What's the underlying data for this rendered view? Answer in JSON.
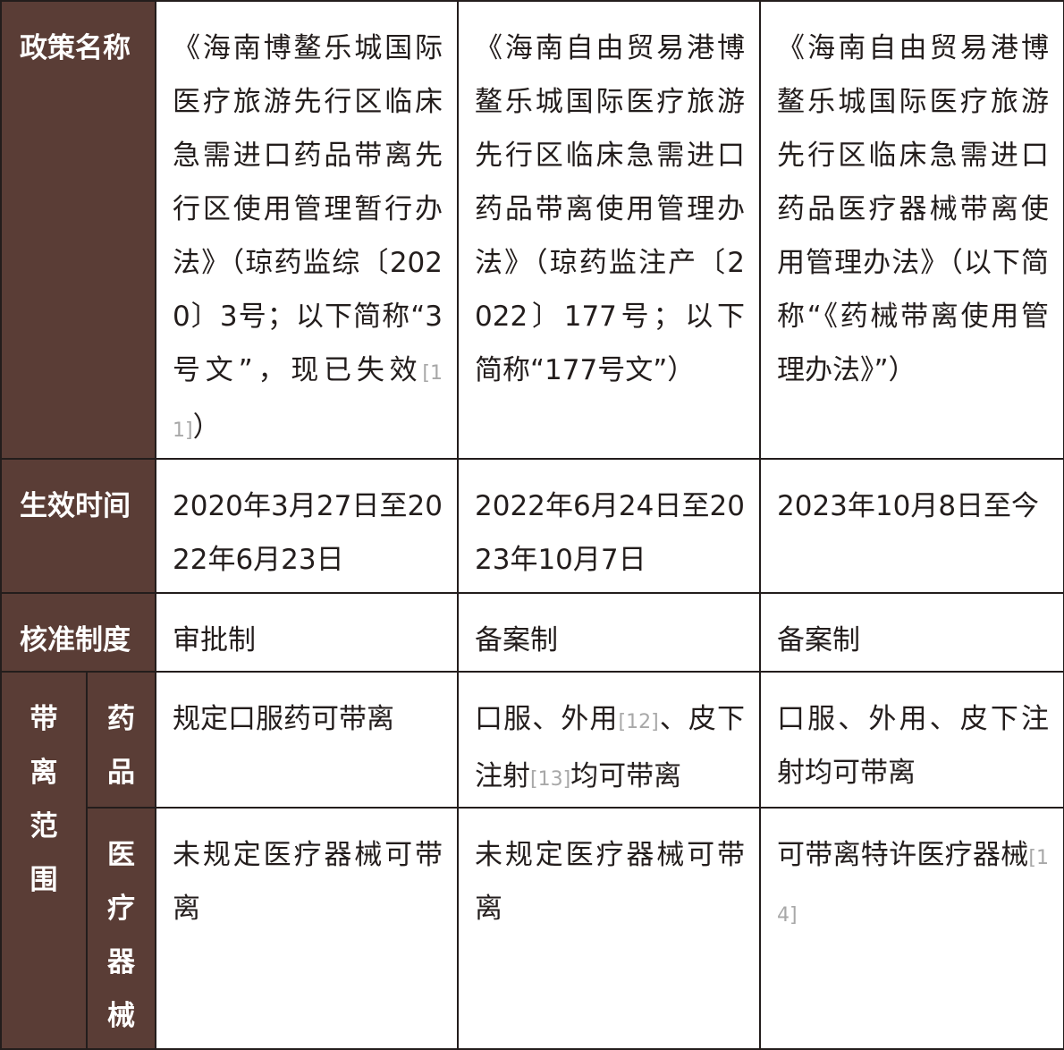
{
  "rows": {
    "policy_name": {
      "label": "政策名称",
      "col1_text": "《海南博鳌乐城国际医疗旅游先行区临床急需进口药品带离先行区使用管理暂行办法》（琼药监综〔2020〕3号；以下简称“3号文”，现已失效",
      "col1_ref": "[11]",
      "col1_tail": "）",
      "col2_text": "《海南自由贸易港博鳌乐城国际医疗旅游先行区临床急需进口药品带离使用管理办法》（琼药监注产〔2022〕177号；以下简称“177号文”）",
      "col3_text": "《海南自由贸易港博鳌乐城国际医疗旅游先行区临床急需进口药品医疗器械带离使用管理办法》（以下简称“《药械带离使用管理办法》”）"
    },
    "effective_time": {
      "label": "生效时间",
      "col1": "2020年3月27日至2022年6月23日",
      "col2": "2022年6月24日至2023年10月7日",
      "col3": "2023年10月8日至今"
    },
    "approval_system": {
      "label": "核准制度",
      "col1": "审批制",
      "col2": "备案制",
      "col3": "备案制"
    },
    "scope": {
      "label_chars": [
        "带",
        "离",
        "范",
        "围"
      ],
      "drugs": {
        "label_chars": [
          "药",
          "品"
        ],
        "col1": "规定口服药可带离",
        "col2_a": "口服、外用",
        "col2_ref1": "[12]",
        "col2_b": "、皮下注射",
        "col2_ref2": "[13]",
        "col2_c": "均可带离",
        "col3": "口服、外用、皮下注射均可带离"
      },
      "devices": {
        "label_chars": [
          "医",
          "疗",
          "器",
          "械"
        ],
        "col1": "未规定医疗器械可带离",
        "col2": "未规定医疗器械可带离",
        "col3_text": "可带离特许医疗器械",
        "col3_ref": "[14]"
      }
    }
  },
  "colors": {
    "header_bg": "#5a3d36",
    "border": "#231d1c",
    "text": "#231d1c",
    "reference": "#a8a8a8"
  }
}
